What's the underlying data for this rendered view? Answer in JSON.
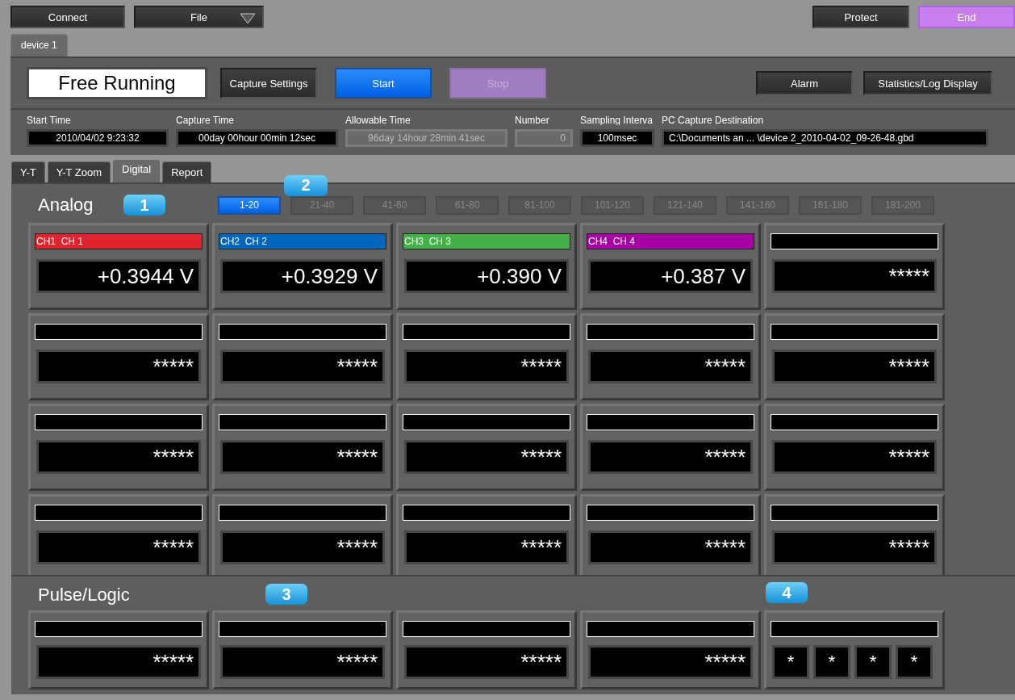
{
  "toolbar": {
    "left": [
      {
        "label": "Connect",
        "kind": "dark",
        "dropdown": false
      },
      {
        "label": "File",
        "kind": "dark",
        "dropdown": true
      }
    ],
    "right": [
      {
        "label": "Protect",
        "kind": "dark"
      },
      {
        "label": "End",
        "kind": "purple"
      }
    ]
  },
  "device_tabs": [
    {
      "label": "device 1",
      "selected": true
    }
  ],
  "capture": {
    "mode": "Free Running",
    "buttons": [
      {
        "label": "Capture Settings",
        "kind": "dark",
        "disabled": false
      },
      {
        "label": "Start",
        "kind": "blue",
        "disabled": false
      },
      {
        "label": "Stop",
        "kind": "purple",
        "disabled": true
      }
    ],
    "right_buttons": [
      {
        "label": "Alarm",
        "kind": "dark"
      },
      {
        "label": "Statistics/Log Display",
        "kind": "dark"
      }
    ]
  },
  "info": [
    {
      "label": "Start Time",
      "value": "2010/04/02 9:23:32",
      "disabled": false
    },
    {
      "label": "Capture Time",
      "value": "00day 00hour 00min 12sec",
      "disabled": false
    },
    {
      "label": "Allowable Time",
      "value": "96day 14hour 28min 41sec",
      "disabled": true
    },
    {
      "label": "Number",
      "value": "0",
      "disabled": true
    },
    {
      "label": "Sampling Interva",
      "value": "100msec",
      "disabled": false
    },
    {
      "label": "PC Capture Destination",
      "value": "C:\\Documents an ... \\device 2_2010-04-02_09-26-48.gbd",
      "disabled": false
    }
  ],
  "view_tabs": [
    {
      "label": "Y-T",
      "selected": false
    },
    {
      "label": "Y-T Zoom",
      "selected": false
    },
    {
      "label": "Digital",
      "selected": true
    },
    {
      "label": "Report",
      "selected": false
    }
  ],
  "analog": {
    "title": "Analog",
    "callouts": [
      "1",
      "2"
    ],
    "ranges": [
      {
        "label": "1-20",
        "selected": true
      },
      {
        "label": "21-40",
        "selected": false
      },
      {
        "label": "41-60",
        "selected": false
      },
      {
        "label": "61-80",
        "selected": false
      },
      {
        "label": "81-100",
        "selected": false
      },
      {
        "label": "101-120",
        "selected": false
      },
      {
        "label": "121-140",
        "selected": false
      },
      {
        "label": "141-160",
        "selected": false
      },
      {
        "label": "161-180",
        "selected": false
      },
      {
        "label": "181-200",
        "selected": false
      }
    ],
    "channels": [
      {
        "name": "CH1  CH 1",
        "color": "#e0242e",
        "value": "+0.3944 V"
      },
      {
        "name": "CH2  CH 2",
        "color": "#0066bb",
        "value": "+0.3929 V"
      },
      {
        "name": "CH3  CH 3",
        "color": "#44b048",
        "value": "+0.390 V"
      },
      {
        "name": "CH4  CH 4",
        "color": "#a400a4",
        "value": "+0.387 V"
      },
      {
        "value": "*****"
      },
      {
        "value": "*****"
      },
      {
        "value": "*****"
      },
      {
        "value": "*****"
      },
      {
        "value": "*****"
      },
      {
        "value": "*****"
      },
      {
        "value": "*****"
      },
      {
        "value": "*****"
      },
      {
        "value": "*****"
      },
      {
        "value": "*****"
      },
      {
        "value": "*****"
      },
      {
        "value": "*****"
      },
      {
        "value": "*****"
      },
      {
        "value": "*****"
      },
      {
        "value": "*****"
      },
      {
        "value": "*****"
      }
    ]
  },
  "pulse": {
    "title": "Pulse/Logic",
    "callouts": [
      "3",
      "4"
    ],
    "channels": [
      {
        "kind": "pulse",
        "value": "*****"
      },
      {
        "kind": "pulse",
        "value": "*****"
      },
      {
        "kind": "pulse",
        "value": "*****"
      },
      {
        "kind": "pulse",
        "value": "*****"
      },
      {
        "kind": "logic",
        "bits": [
          "*",
          "*",
          "*",
          "*"
        ]
      }
    ]
  }
}
